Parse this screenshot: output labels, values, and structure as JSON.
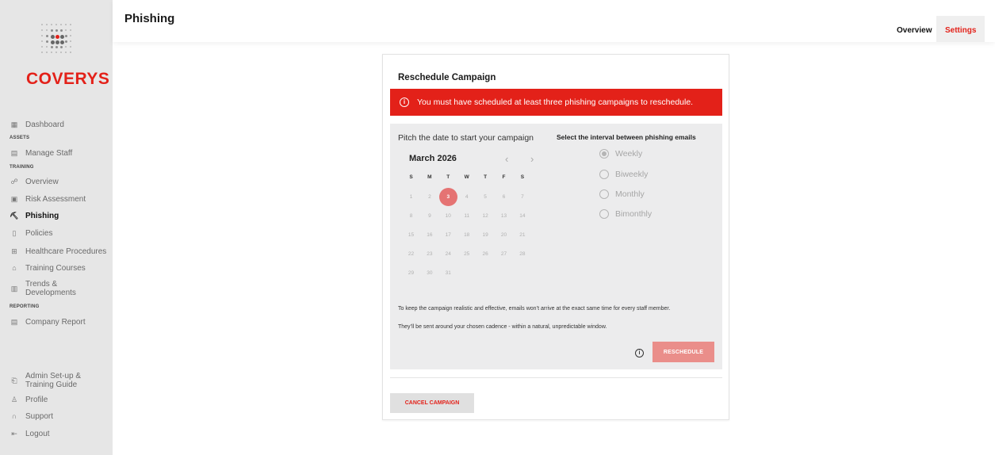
{
  "brand": {
    "name": "COVERYS",
    "accent": "#e32119"
  },
  "page": {
    "title": "Phishing"
  },
  "header": {
    "tabs": [
      {
        "label": "Overview"
      },
      {
        "label": "Settings",
        "active": true
      }
    ]
  },
  "sidebar": {
    "items": [
      {
        "label": "Dashboard",
        "icon": "dashboard-icon"
      },
      {
        "section": "ASSETS"
      },
      {
        "label": "Manage Staff",
        "icon": "staff-icon"
      },
      {
        "section": "TRAINING"
      },
      {
        "label": "Overview",
        "icon": "people-icon"
      },
      {
        "label": "Risk Assessment",
        "icon": "assessment-icon"
      },
      {
        "label": "Phishing",
        "icon": "hook-icon",
        "active": true
      },
      {
        "label": "Policies",
        "icon": "document-icon"
      },
      {
        "label": "Healthcare Procedures",
        "icon": "clipboard-icon"
      },
      {
        "label": "Training Courses",
        "icon": "graduation-icon"
      },
      {
        "label": "Trends & Developments",
        "icon": "newspaper-icon"
      },
      {
        "section": "REPORTING"
      },
      {
        "label": "Company Report",
        "icon": "report-icon"
      },
      {
        "label": "Admin Set-up & Training Guide",
        "icon": "guide-icon"
      },
      {
        "label": "Profile",
        "icon": "user-icon"
      },
      {
        "label": "Support",
        "icon": "headset-icon"
      },
      {
        "label": "Logout",
        "icon": "logout-icon"
      }
    ]
  },
  "card": {
    "title": "Reschedule Campaign",
    "alert": "You must have scheduled at least three phishing campaigns to reschedule.",
    "pitch_label": "Pitch the date to start your campaign",
    "calendar": {
      "month": "March 2026",
      "weekdays": [
        "S",
        "M",
        "T",
        "W",
        "T",
        "F",
        "S"
      ],
      "days": [
        [
          "1",
          "2",
          "3",
          "4",
          "5",
          "6",
          "7"
        ],
        [
          "8",
          "9",
          "10",
          "11",
          "12",
          "13",
          "14"
        ],
        [
          "15",
          "16",
          "17",
          "18",
          "19",
          "20",
          "21"
        ],
        [
          "22",
          "23",
          "24",
          "25",
          "26",
          "27",
          "28"
        ],
        [
          "29",
          "30",
          "31"
        ]
      ],
      "selected": "3"
    },
    "interval_label": "Select the interval between phishing emails",
    "intervals": [
      {
        "label": "Weekly",
        "checked": true
      },
      {
        "label": "Biweekly",
        "checked": false
      },
      {
        "label": "Monthly",
        "checked": false
      },
      {
        "label": "Bimonthly",
        "checked": false
      }
    ],
    "note1": "To keep the campaign realistic and effective, emails won’t arrive at the exact same time for every staff member.",
    "note2": "They’ll be sent around your chosen cadence - within a natural, unpredictable window.",
    "reschedule_label": "RESCHEDULE",
    "cancel_label": "CANCEL CAMPAIGN"
  }
}
